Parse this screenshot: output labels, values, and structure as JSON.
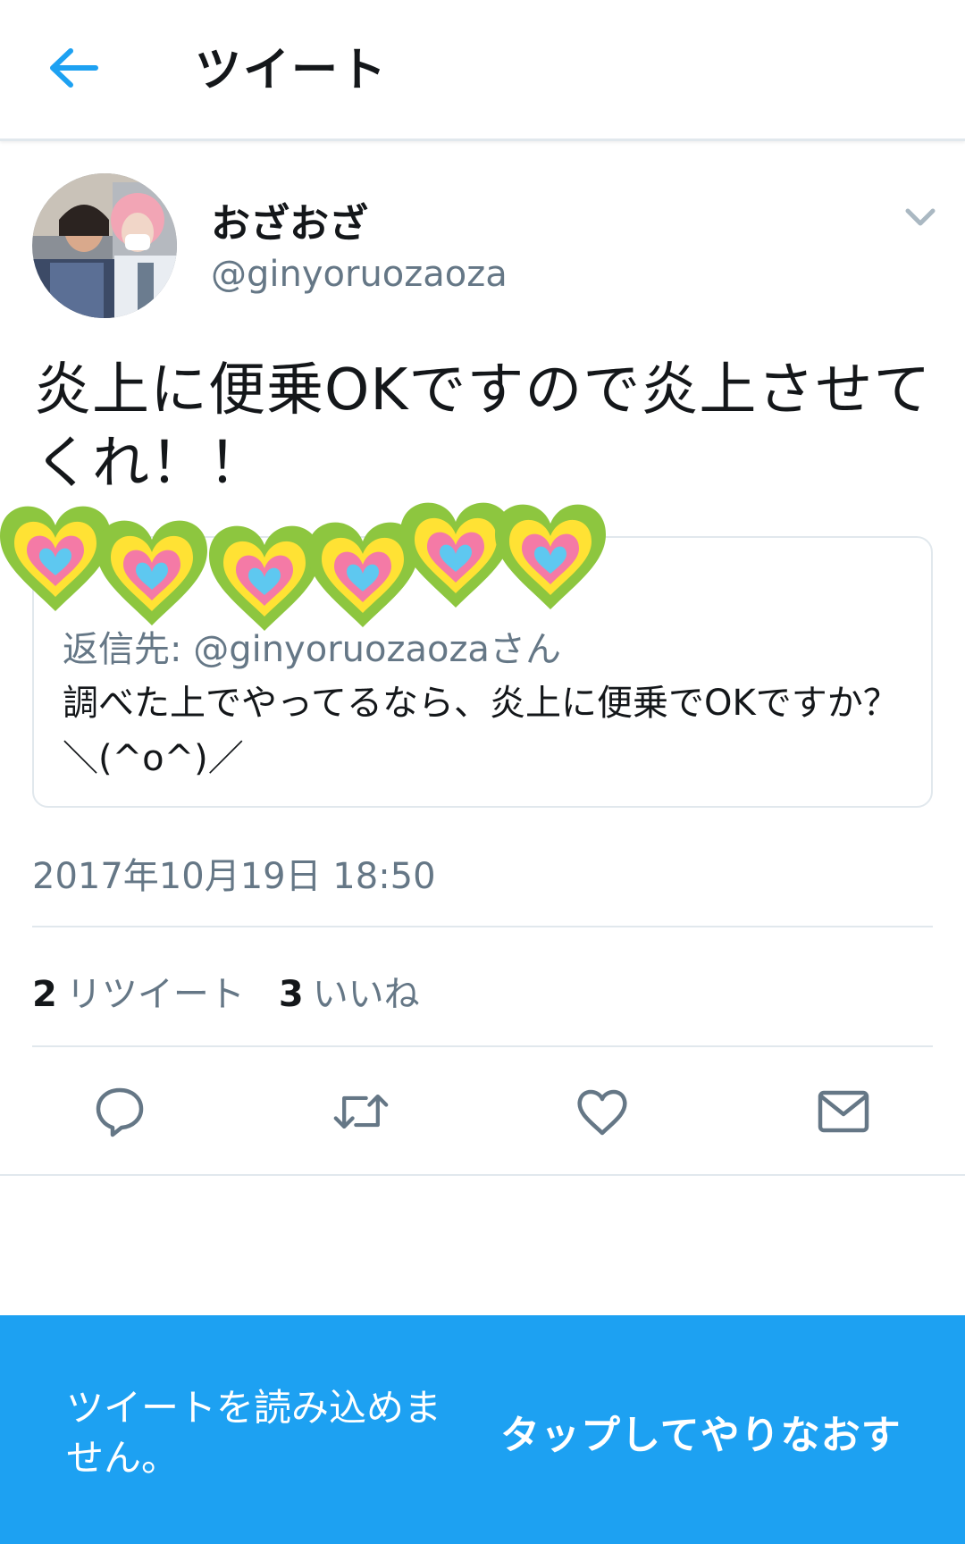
{
  "header": {
    "title": "ツイート",
    "back_icon": "arrow-left-icon",
    "accent_color": "#1da1f2"
  },
  "author": {
    "display_name": "おざおざ",
    "handle": "@ginyoruozaoza"
  },
  "tweet": {
    "text": "炎上に便乗OKですので炎上させてくれ！！",
    "timestamp": "2017年10月19日 18:50"
  },
  "quoted_tweet": {
    "author_visible": "",
    "reply_to": "返信先: @ginyoruozaozaさん",
    "text": "調べた上でやってるなら、炎上に便乗でOKですか？＼(^o^)／"
  },
  "stats": {
    "retweet_count": "2",
    "retweet_label": "リツイート",
    "like_count": "3",
    "like_label": "いいね"
  },
  "actions": {
    "reply_icon": "reply-icon",
    "retweet_icon": "retweet-icon",
    "like_icon": "heart-icon",
    "share_icon": "envelope-icon"
  },
  "error_banner": {
    "message": "ツイートを読み込めません。",
    "retry_label": "タップしてやりなおす"
  }
}
